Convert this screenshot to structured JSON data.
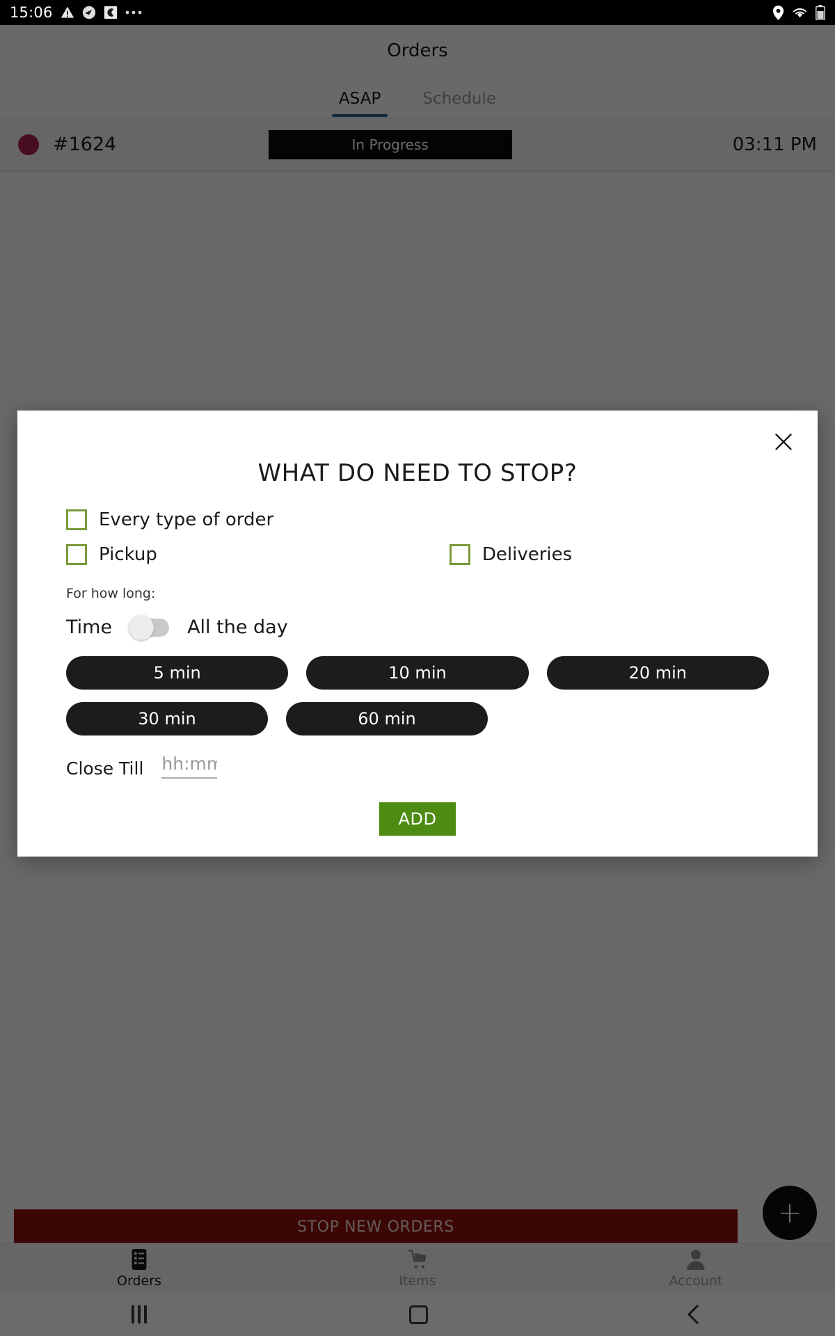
{
  "statusbar": {
    "time": "15:06",
    "left_icons": [
      "warning-triangle-icon",
      "app-badge-icon",
      "app-square-icon",
      "more-dots-icon"
    ],
    "right_icons": [
      "location-pin-icon",
      "wifi-icon",
      "battery-icon"
    ]
  },
  "appbar": {
    "title": "Orders"
  },
  "tabs": [
    {
      "label": "ASAP",
      "active": true
    },
    {
      "label": "Schedule",
      "active": false
    }
  ],
  "order": {
    "id": "#1624",
    "status": "In Progress",
    "time": "03:11 PM",
    "dot_color": "#a9224d"
  },
  "stop_bar": {
    "label": "STOP NEW ORDERS",
    "color": "#8e0f0b"
  },
  "fab": {
    "label": "+"
  },
  "bottom_nav": [
    {
      "label": "Orders",
      "icon": "list-icon",
      "active": true
    },
    {
      "label": "Items",
      "icon": "cart-icon",
      "active": false
    },
    {
      "label": "Account",
      "icon": "person-icon",
      "active": false
    }
  ],
  "system_nav": {
    "recents": "recents-icon",
    "home": "home-icon",
    "back": "back-icon"
  },
  "modal": {
    "close_icon": "close-icon",
    "title": "WHAT DO NEED TO STOP?",
    "checkboxes": [
      {
        "label": "Every type of order",
        "checked": false
      },
      {
        "label": "Pickup",
        "checked": false
      },
      {
        "label": "Deliveries",
        "checked": false
      }
    ],
    "duration_label": "For how long:",
    "time_label": "Time",
    "toggle_on": false,
    "allday_label": "All the day",
    "durations_row1": [
      "5 min",
      "10 min",
      "20 min"
    ],
    "durations_row2": [
      "30 min",
      "60 min"
    ],
    "close_till_label": "Close Till",
    "close_till_value": "",
    "close_till_placeholder": "hh:mm",
    "add_label": "ADD",
    "add_color": "#4d8b12",
    "checkbox_color": "#7a9a3a"
  }
}
